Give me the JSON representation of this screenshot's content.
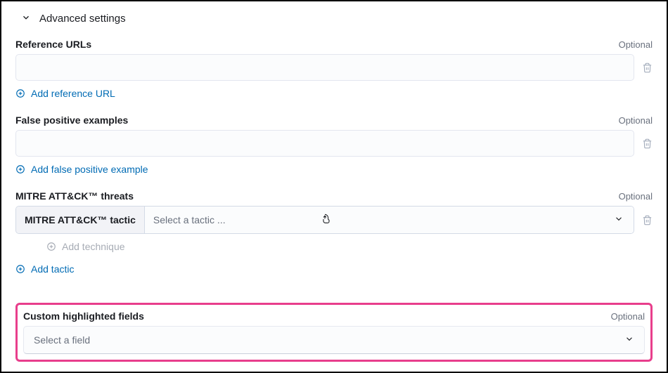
{
  "header": {
    "title": "Advanced settings"
  },
  "optional_label": "Optional",
  "reference_urls": {
    "label": "Reference URLs",
    "value": "",
    "add_label": "Add reference URL"
  },
  "false_positive": {
    "label": "False positive examples",
    "value": "",
    "add_label": "Add false positive example"
  },
  "mitre": {
    "label": "MITRE ATT&CK™ threats",
    "prepend": "MITRE ATT&CK™ tactic",
    "placeholder": "Select a tactic ...",
    "add_technique": "Add technique",
    "add_tactic": "Add tactic"
  },
  "highlighted": {
    "label": "Custom highlighted fields",
    "placeholder": "Select a field"
  }
}
